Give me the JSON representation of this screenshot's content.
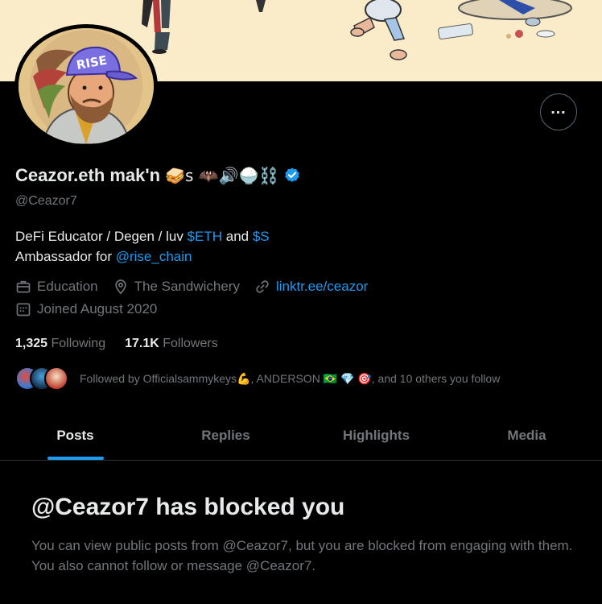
{
  "profile": {
    "display_name": "Ceazor.eth mak'n",
    "name_suffix": "🥪s 🦇🔊🍚⛓️",
    "handle": "@Ceazor7",
    "bio_line1_a": "DeFi Educator / Degen / luv ",
    "bio_link_eth": "$ETH",
    "bio_line1_b": " and ",
    "bio_link_s": "$S",
    "bio_line2_a": "Ambassador for ",
    "bio_link_rise": "@rise_chain",
    "category": "Education",
    "location": "The Sandwichery",
    "website": "linktr.ee/ceazor",
    "joined": "Joined August 2020",
    "hat_text": "RISE"
  },
  "stats": {
    "following_count": "1,325",
    "following_label": "Following",
    "followers_count": "17.1K",
    "followers_label": "Followers"
  },
  "followed_by": "Followed by Officialsammykeys💪, ANDERSON 🇧🇷 💎 🎯, and 10 others you follow",
  "tabs": [
    "Posts",
    "Replies",
    "Highlights",
    "Media"
  ],
  "blocked": {
    "title": "@Ceazor7 has blocked you",
    "message": "You can view public posts from @Ceazor7, but you are blocked from engaging with them. You also cannot follow or message @Ceazor7."
  },
  "colors": {
    "accent": "#1d9bf0",
    "muted": "#71767b",
    "banner": "#fbecc9"
  },
  "icons": [
    "more-icon",
    "verified-badge-icon",
    "briefcase-icon",
    "location-pin-icon",
    "link-icon",
    "calendar-icon"
  ]
}
